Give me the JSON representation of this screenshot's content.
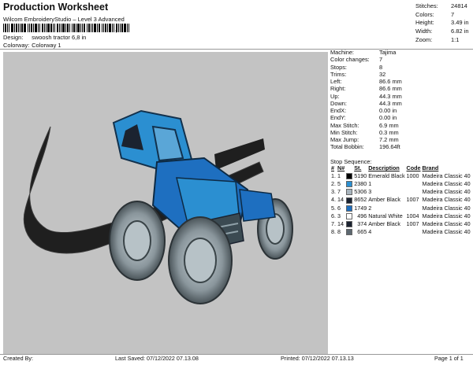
{
  "header": {
    "title": "Production Worksheet",
    "subtitle": "Wilcom EmbroideryStudio – Level 3 Advanced",
    "barcode_mark": ",",
    "design_label": "Design:",
    "design_value": "swoosh tractor 6,8 in",
    "colorway_label": "Colorway:",
    "colorway_value": "Colorway 1"
  },
  "stats": [
    {
      "label": "Stitches:",
      "value": "24814"
    },
    {
      "label": "Colors:",
      "value": "7"
    },
    {
      "label": "Height:",
      "value": "3.49 in"
    },
    {
      "label": "Width:",
      "value": "6.82 in"
    },
    {
      "label": "Zoom:",
      "value": "1:1"
    }
  ],
  "info": [
    {
      "label": "Machine:",
      "value": "Tajima"
    },
    {
      "label": "Color changes:",
      "value": "7"
    },
    {
      "label": "Stops:",
      "value": "8"
    },
    {
      "label": "Trims:",
      "value": "32"
    },
    {
      "label": "Left:",
      "value": "86.6 mm"
    },
    {
      "label": "Right:",
      "value": "86.6 mm"
    },
    {
      "label": "Up:",
      "value": "44.3 mm"
    },
    {
      "label": "Down:",
      "value": "44.3 mm"
    },
    {
      "label": "EndX:",
      "value": "0.00 in"
    },
    {
      "label": "EndY:",
      "value": "0.00 in"
    },
    {
      "label": "Max Stitch:",
      "value": "6.9 mm"
    },
    {
      "label": "Min Stitch:",
      "value": "0.3 mm"
    },
    {
      "label": "Max Jump:",
      "value": "7.2 mm"
    },
    {
      "label": "Total Bobbin:",
      "value": "196.64ft"
    }
  ],
  "stop_sequence": {
    "title": "Stop Sequence:",
    "headers": [
      "#",
      "N#",
      "St.",
      "Description",
      "Code",
      "Brand"
    ],
    "rows": [
      {
        "n": "1.",
        "nn": "1",
        "color": "#000000",
        "st": "5190",
        "desc": "Emerald Black",
        "code": "1000",
        "brand": "Madeira Classic 40"
      },
      {
        "n": "2.",
        "nn": "5",
        "color": "#2b8fd1",
        "st": "2380",
        "desc": "1",
        "code": "",
        "brand": "Madeira Classic 40"
      },
      {
        "n": "3.",
        "nn": "7",
        "color": "#a8b4bd",
        "st": "5306",
        "desc": "3",
        "code": "",
        "brand": "Madeira Classic 40"
      },
      {
        "n": "4.",
        "nn": "14",
        "color": "#1b2330",
        "st": "8652",
        "desc": "Amber Black",
        "code": "1007",
        "brand": "Madeira Classic 40"
      },
      {
        "n": "5.",
        "nn": "6",
        "color": "#1e6fc0",
        "st": "1749",
        "desc": "2",
        "code": "",
        "brand": "Madeira Classic 40"
      },
      {
        "n": "6.",
        "nn": "3",
        "color": "#ffffff",
        "st": "496",
        "desc": "Natural White",
        "code": "1004",
        "brand": "Madeira Classic 40"
      },
      {
        "n": "7.",
        "nn": "14",
        "color": "#1b2330",
        "st": "374",
        "desc": "Amber Black",
        "code": "1007",
        "brand": "Madeira Classic 40"
      },
      {
        "n": "8.",
        "nn": "8",
        "color": "#5d6870",
        "st": "665",
        "desc": "4",
        "code": "",
        "brand": "Madeira Classic 40"
      }
    ]
  },
  "footer": {
    "created_by": "Created By:",
    "last_saved": "Last Saved: 07/12/2022 07.13.08",
    "printed": "Printed: 07/12/2022 07.13.13",
    "page": "Page 1 of 1"
  }
}
